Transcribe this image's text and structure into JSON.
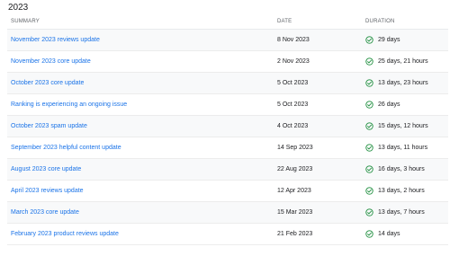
{
  "section": {
    "year": "2023"
  },
  "table": {
    "headers": {
      "summary": "SUMMARY",
      "date": "DATE",
      "duration": "DURATION"
    },
    "rows": [
      {
        "summary": "November 2023 reviews update",
        "date": "8 Nov 2023",
        "duration": "29 days"
      },
      {
        "summary": "November 2023 core update",
        "date": "2 Nov 2023",
        "duration": "25 days, 21 hours"
      },
      {
        "summary": "October 2023 core update",
        "date": "5 Oct 2023",
        "duration": "13 days, 23 hours"
      },
      {
        "summary": "Ranking is experiencing an ongoing issue",
        "date": "5 Oct 2023",
        "duration": "26 days"
      },
      {
        "summary": "October 2023 spam update",
        "date": "4 Oct 2023",
        "duration": "15 days, 12 hours"
      },
      {
        "summary": "September 2023 helpful content update",
        "date": "14 Sep 2023",
        "duration": "13 days, 11 hours"
      },
      {
        "summary": "August 2023 core update",
        "date": "22 Aug 2023",
        "duration": "16 days, 3 hours"
      },
      {
        "summary": "April 2023 reviews update",
        "date": "12 Apr 2023",
        "duration": "13 days, 2 hours"
      },
      {
        "summary": "March 2023 core update",
        "date": "15 Mar 2023",
        "duration": "13 days, 7 hours"
      },
      {
        "summary": "February 2023 product reviews update",
        "date": "21 Feb 2023",
        "duration": "14 days"
      }
    ]
  },
  "icons": {
    "status": "check-circle-icon"
  },
  "colors": {
    "link": "#1a73e8",
    "status_ok": "#1e8e3e",
    "header_text": "#5f6368",
    "row_alt_background": "#f8f9fa"
  }
}
